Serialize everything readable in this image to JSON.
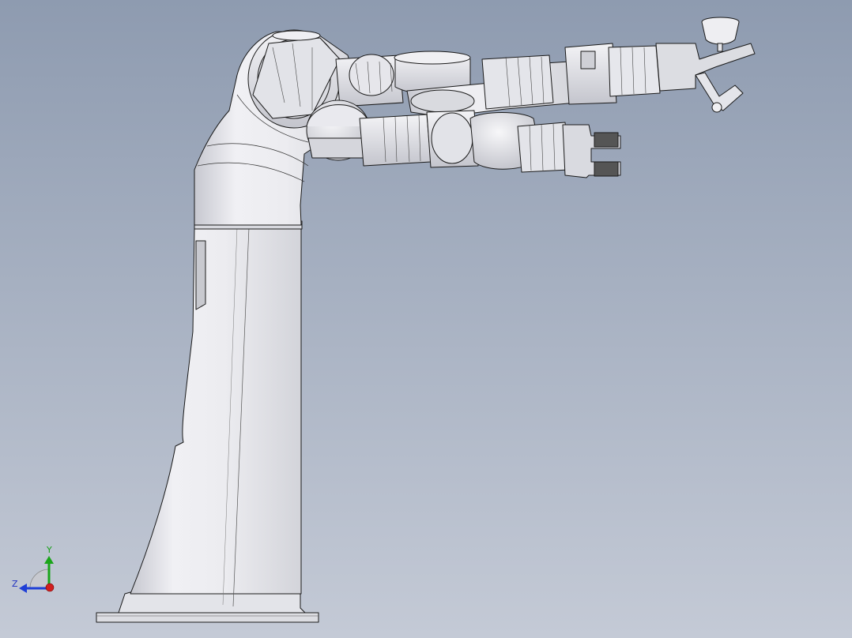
{
  "viewport": {
    "background_top": "#8e9bb0",
    "background_bottom": "#c4cad6"
  },
  "model": {
    "body_color": "#e9e9ee",
    "shade_color": "#c9cad1",
    "edge_color": "#1a1a1a"
  },
  "triad": {
    "y_label": "Y",
    "z_label": "Z",
    "y_color": "#1aa51a",
    "z_color": "#1f3fd6",
    "x_color": "#d11f1f",
    "label_y_color": "#15a015",
    "label_z_color": "#2030c0"
  }
}
